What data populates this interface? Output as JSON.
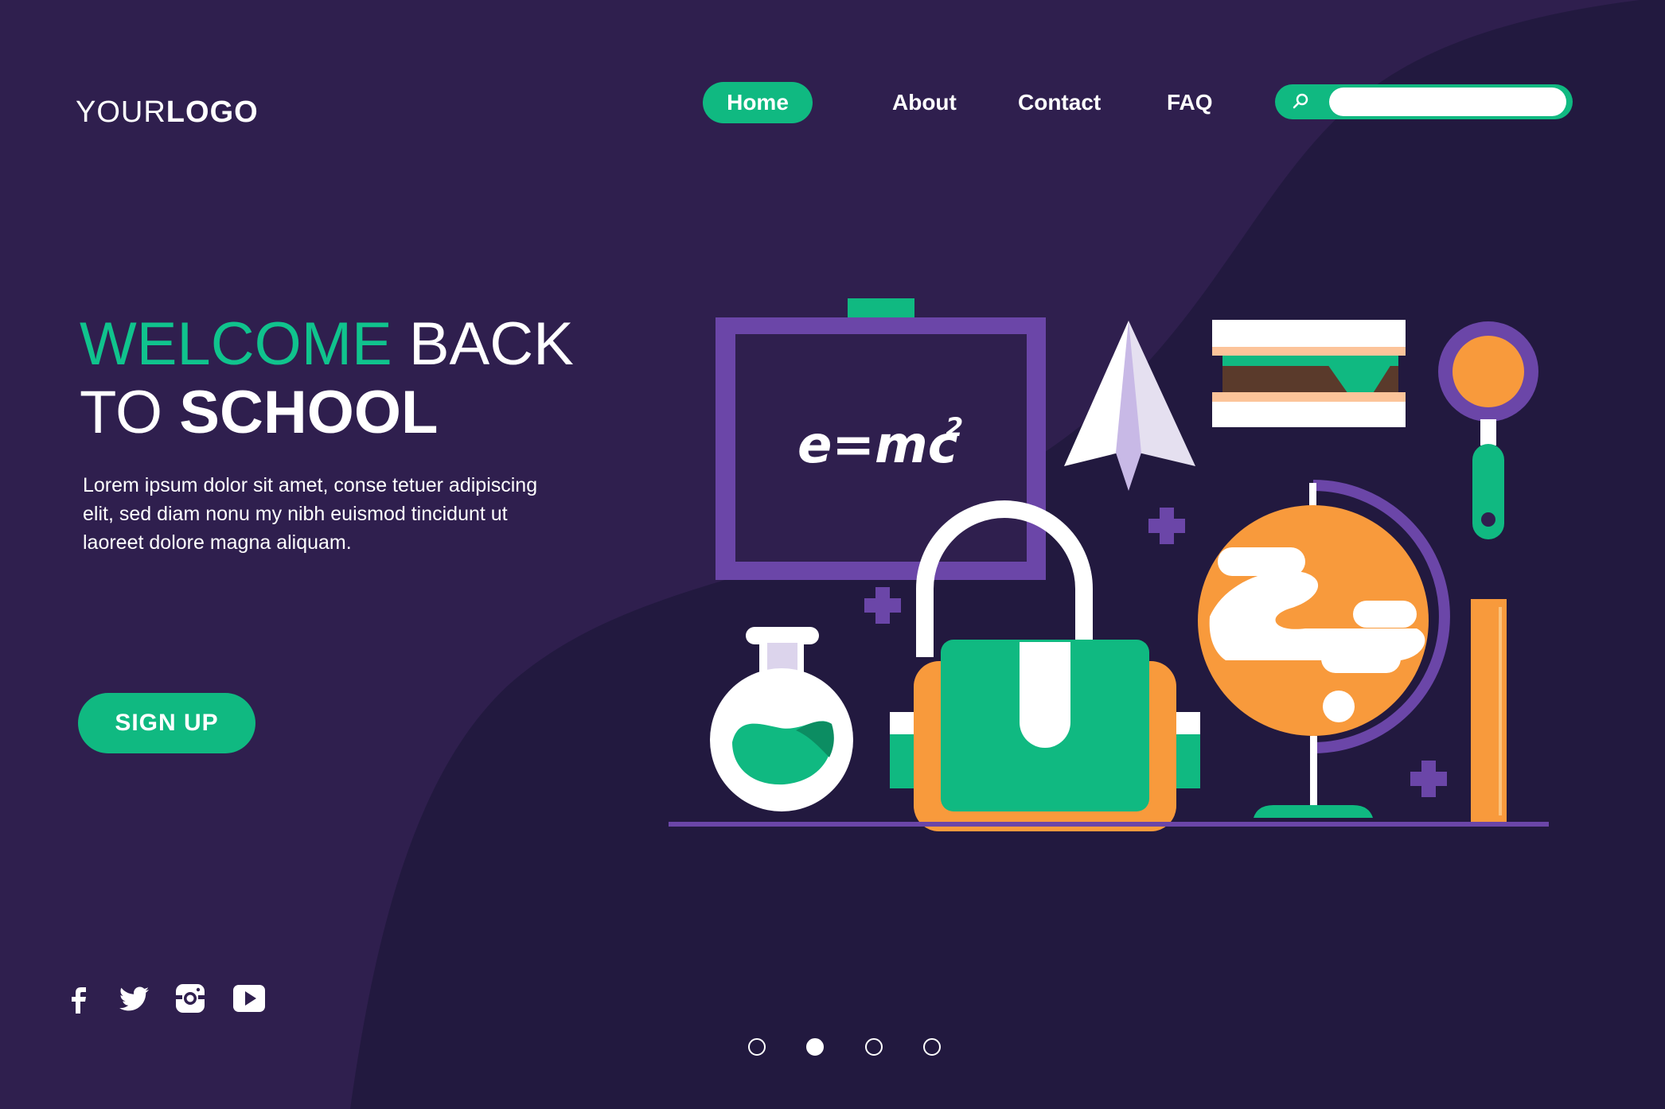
{
  "logo": {
    "light": "YOUR",
    "bold": "LOGO"
  },
  "nav": {
    "home": "Home",
    "about": "About",
    "contact": "Contact",
    "faq": "FAQ"
  },
  "search": {
    "placeholder": "",
    "value": ""
  },
  "hero": {
    "title_green": "WELCOME",
    "title_rest": " BACK",
    "title_line2_light": "TO ",
    "title_line2_bold": "SCHOOL",
    "description": "Lorem ipsum dolor sit amet, conse tetuer adipiscing elit, sed diam nonu my nibh euismod tincidunt ut laoreet dolore magna aliquam.",
    "signup_label": "SIGN UP"
  },
  "illustration": {
    "formula": "e=mc",
    "formula_sup": "2"
  },
  "social": [
    "facebook-icon",
    "twitter-icon",
    "instagram-icon",
    "youtube-icon"
  ],
  "carousel": {
    "count": 4,
    "active_index": 1
  },
  "colors": {
    "background": "#2f1f4e",
    "wave": "#22193f",
    "accent": "#10b981",
    "orange": "#f89a3c",
    "purple": "#6b46a8",
    "white": "#ffffff"
  }
}
